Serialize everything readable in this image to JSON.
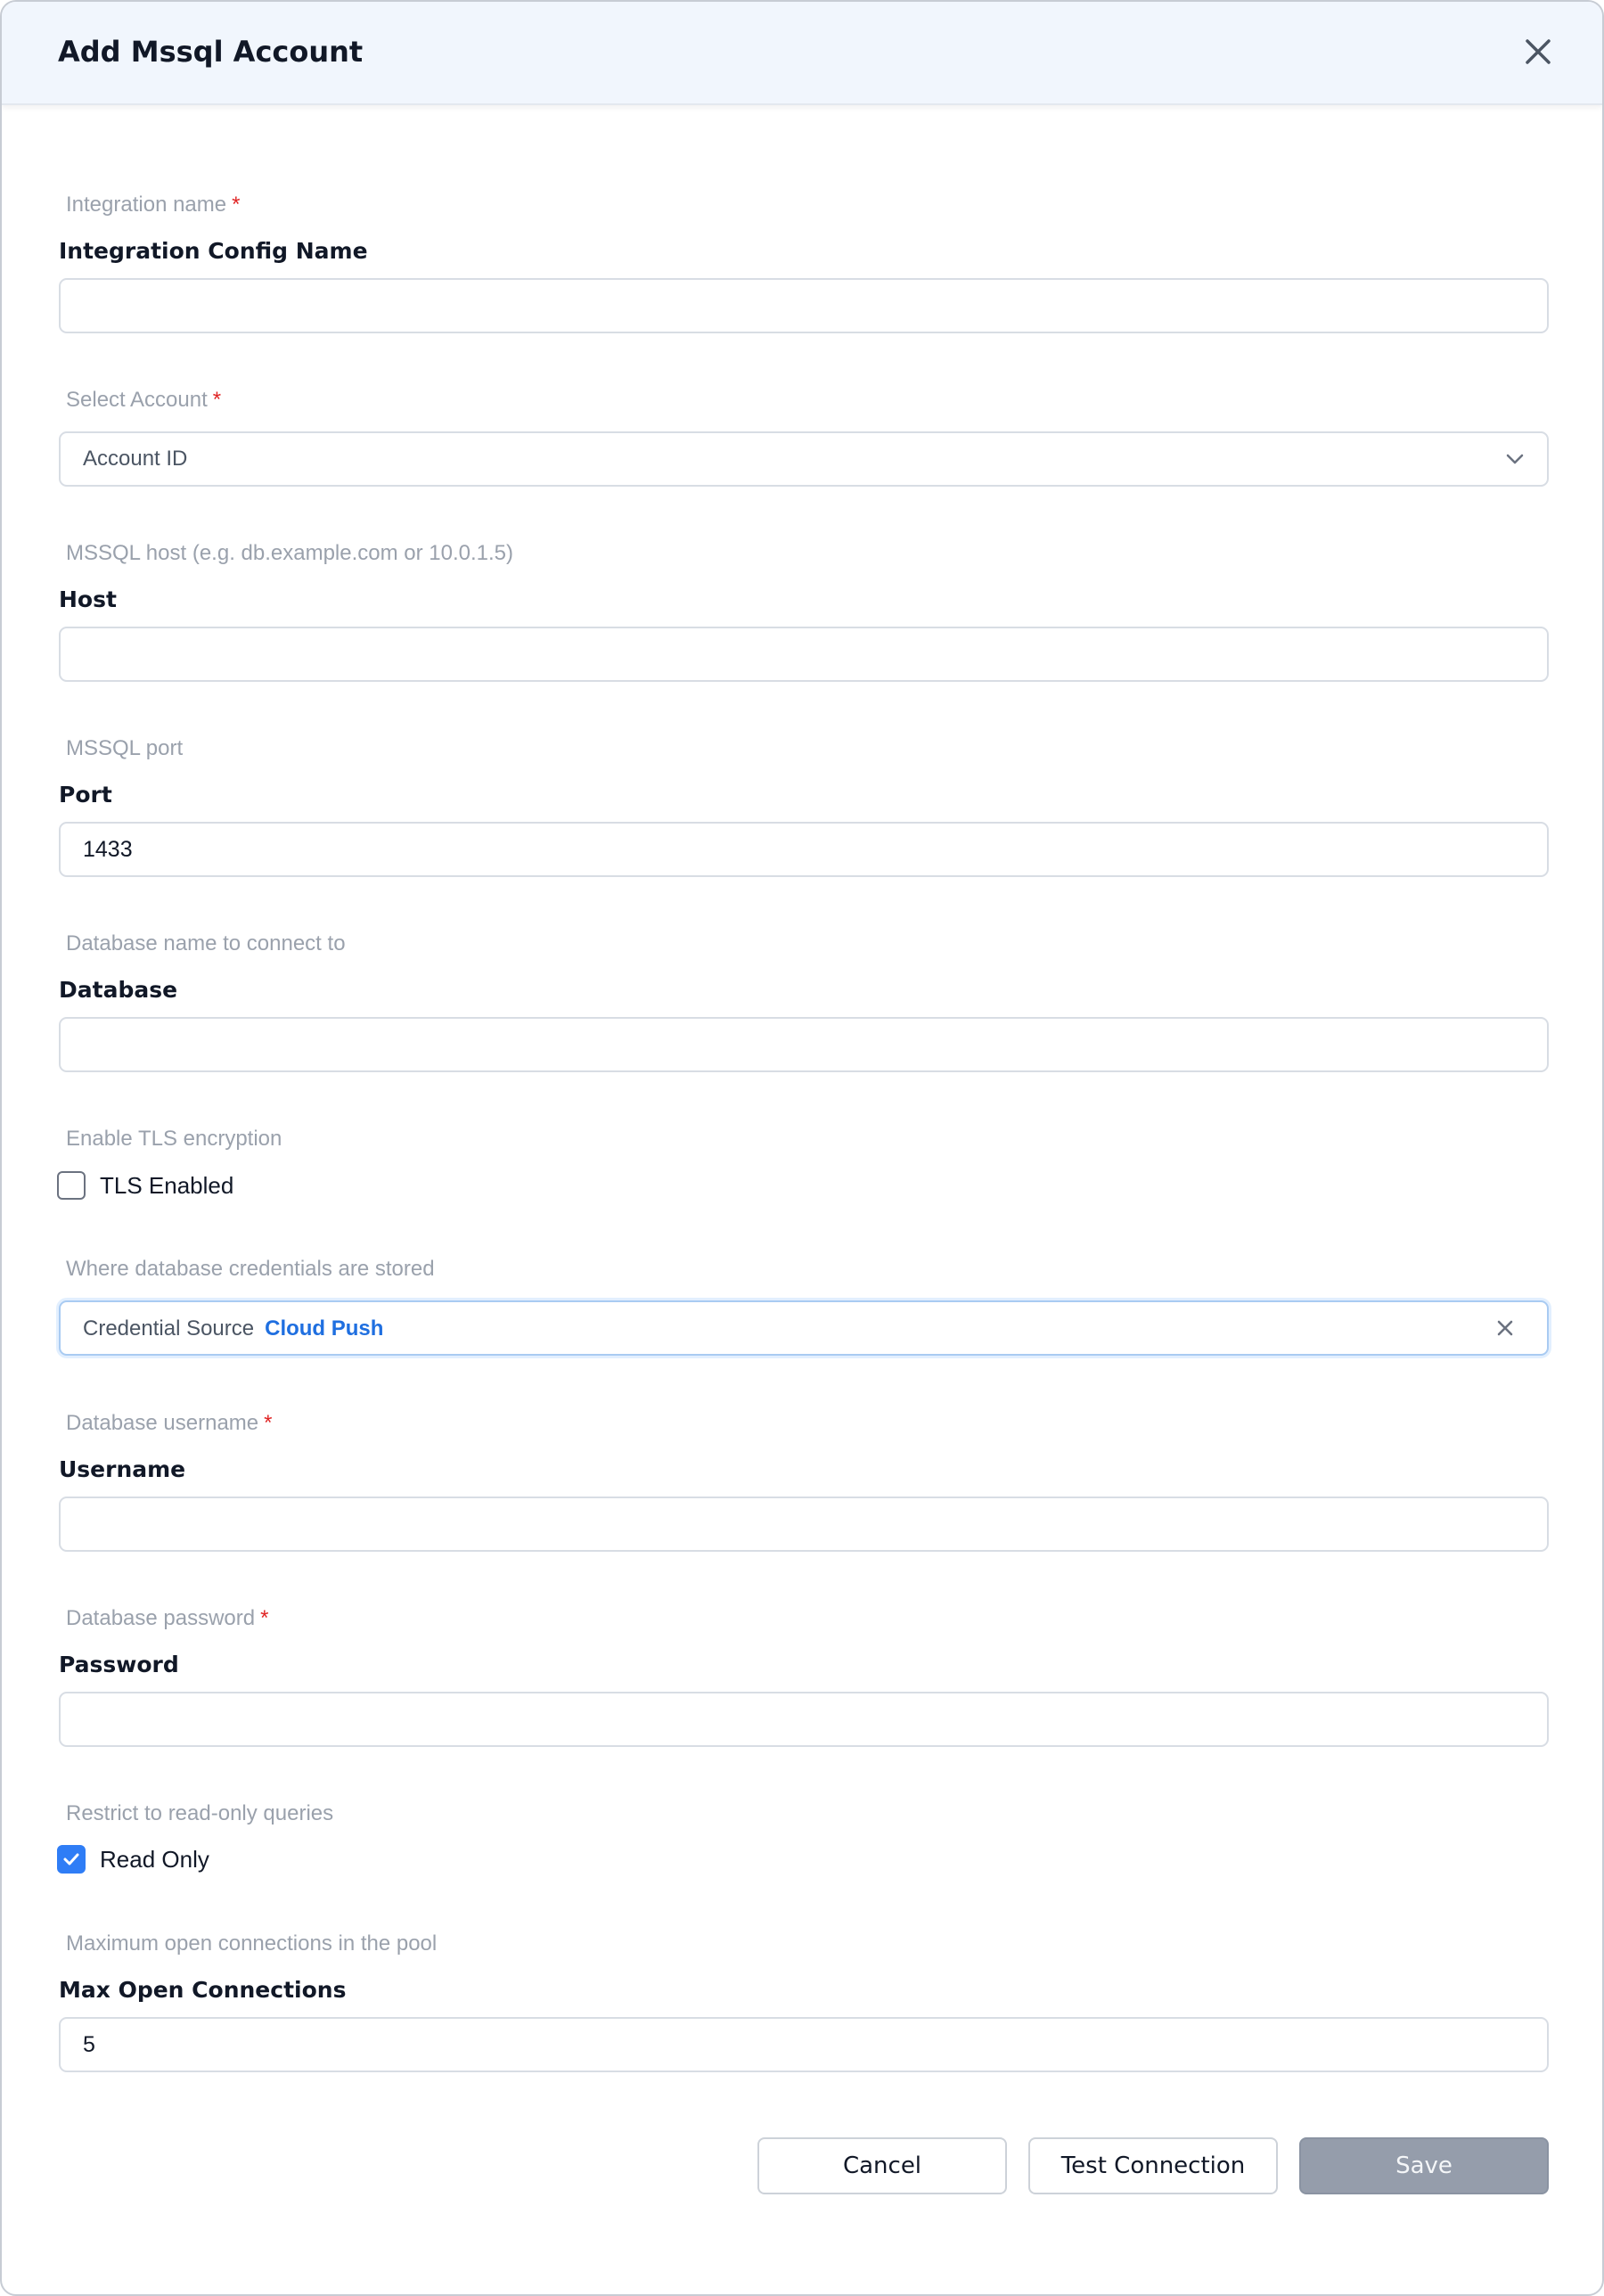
{
  "dialog": {
    "title": "Add Mssql Account"
  },
  "fields": {
    "integration_name": {
      "hint": "Integration name",
      "required_mark": "*",
      "label": "Integration Config Name",
      "value": ""
    },
    "account": {
      "hint": "Select Account",
      "required_mark": "*",
      "selected": "Account ID"
    },
    "host": {
      "hint": "MSSQL host (e.g. db.example.com or 10.0.1.5)",
      "label": "Host",
      "value": ""
    },
    "port": {
      "hint": "MSSQL port",
      "label": "Port",
      "value": "1433"
    },
    "database": {
      "hint": "Database name to connect to",
      "label": "Database",
      "value": ""
    },
    "tls": {
      "hint": "Enable TLS encryption",
      "label": "TLS Enabled",
      "checked": false
    },
    "credential_source": {
      "hint": "Where database credentials are stored",
      "key": "Credential Source",
      "value": "Cloud Push"
    },
    "username": {
      "hint": "Database username",
      "required_mark": "*",
      "label": "Username",
      "value": ""
    },
    "password": {
      "hint": "Database password",
      "required_mark": "*",
      "label": "Password",
      "value": ""
    },
    "read_only": {
      "hint": "Restrict to read-only queries",
      "label": "Read Only",
      "checked": true
    },
    "max_open_connections": {
      "hint": "Maximum open connections in the pool",
      "label": "Max Open Connections",
      "value": "5"
    }
  },
  "footer": {
    "cancel_label": "Cancel",
    "test_label": "Test Connection",
    "save_label": "Save"
  },
  "colors": {
    "accent": "#2f7df6",
    "link": "#1f6fe0",
    "required": "#e02424",
    "header_bg": "#f1f6fd",
    "save_disabled": "#959dab"
  },
  "icons": {
    "close": "close-icon",
    "dropdown": "chevron-down-icon",
    "clear": "clear-icon",
    "check": "check-icon"
  }
}
